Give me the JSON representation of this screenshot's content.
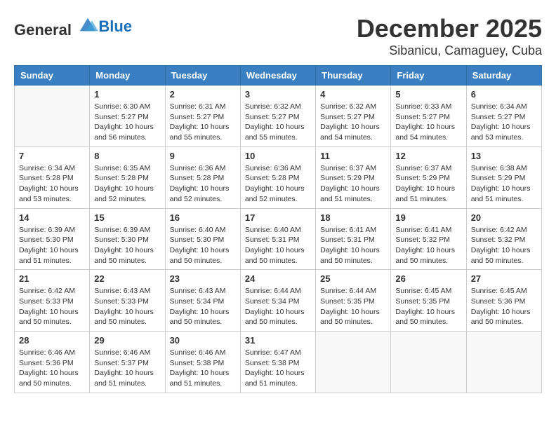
{
  "header": {
    "logo_general": "General",
    "logo_blue": "Blue",
    "month_year": "December 2025",
    "location": "Sibanicu, Camaguey, Cuba"
  },
  "days_of_week": [
    "Sunday",
    "Monday",
    "Tuesday",
    "Wednesday",
    "Thursday",
    "Friday",
    "Saturday"
  ],
  "weeks": [
    [
      {
        "day": "",
        "info": ""
      },
      {
        "day": "1",
        "info": "Sunrise: 6:30 AM\nSunset: 5:27 PM\nDaylight: 10 hours\nand 56 minutes."
      },
      {
        "day": "2",
        "info": "Sunrise: 6:31 AM\nSunset: 5:27 PM\nDaylight: 10 hours\nand 55 minutes."
      },
      {
        "day": "3",
        "info": "Sunrise: 6:32 AM\nSunset: 5:27 PM\nDaylight: 10 hours\nand 55 minutes."
      },
      {
        "day": "4",
        "info": "Sunrise: 6:32 AM\nSunset: 5:27 PM\nDaylight: 10 hours\nand 54 minutes."
      },
      {
        "day": "5",
        "info": "Sunrise: 6:33 AM\nSunset: 5:27 PM\nDaylight: 10 hours\nand 54 minutes."
      },
      {
        "day": "6",
        "info": "Sunrise: 6:34 AM\nSunset: 5:27 PM\nDaylight: 10 hours\nand 53 minutes."
      }
    ],
    [
      {
        "day": "7",
        "info": "Sunrise: 6:34 AM\nSunset: 5:28 PM\nDaylight: 10 hours\nand 53 minutes."
      },
      {
        "day": "8",
        "info": "Sunrise: 6:35 AM\nSunset: 5:28 PM\nDaylight: 10 hours\nand 52 minutes."
      },
      {
        "day": "9",
        "info": "Sunrise: 6:36 AM\nSunset: 5:28 PM\nDaylight: 10 hours\nand 52 minutes."
      },
      {
        "day": "10",
        "info": "Sunrise: 6:36 AM\nSunset: 5:28 PM\nDaylight: 10 hours\nand 52 minutes."
      },
      {
        "day": "11",
        "info": "Sunrise: 6:37 AM\nSunset: 5:29 PM\nDaylight: 10 hours\nand 51 minutes."
      },
      {
        "day": "12",
        "info": "Sunrise: 6:37 AM\nSunset: 5:29 PM\nDaylight: 10 hours\nand 51 minutes."
      },
      {
        "day": "13",
        "info": "Sunrise: 6:38 AM\nSunset: 5:29 PM\nDaylight: 10 hours\nand 51 minutes."
      }
    ],
    [
      {
        "day": "14",
        "info": "Sunrise: 6:39 AM\nSunset: 5:30 PM\nDaylight: 10 hours\nand 51 minutes."
      },
      {
        "day": "15",
        "info": "Sunrise: 6:39 AM\nSunset: 5:30 PM\nDaylight: 10 hours\nand 50 minutes."
      },
      {
        "day": "16",
        "info": "Sunrise: 6:40 AM\nSunset: 5:30 PM\nDaylight: 10 hours\nand 50 minutes."
      },
      {
        "day": "17",
        "info": "Sunrise: 6:40 AM\nSunset: 5:31 PM\nDaylight: 10 hours\nand 50 minutes."
      },
      {
        "day": "18",
        "info": "Sunrise: 6:41 AM\nSunset: 5:31 PM\nDaylight: 10 hours\nand 50 minutes."
      },
      {
        "day": "19",
        "info": "Sunrise: 6:41 AM\nSunset: 5:32 PM\nDaylight: 10 hours\nand 50 minutes."
      },
      {
        "day": "20",
        "info": "Sunrise: 6:42 AM\nSunset: 5:32 PM\nDaylight: 10 hours\nand 50 minutes."
      }
    ],
    [
      {
        "day": "21",
        "info": "Sunrise: 6:42 AM\nSunset: 5:33 PM\nDaylight: 10 hours\nand 50 minutes."
      },
      {
        "day": "22",
        "info": "Sunrise: 6:43 AM\nSunset: 5:33 PM\nDaylight: 10 hours\nand 50 minutes."
      },
      {
        "day": "23",
        "info": "Sunrise: 6:43 AM\nSunset: 5:34 PM\nDaylight: 10 hours\nand 50 minutes."
      },
      {
        "day": "24",
        "info": "Sunrise: 6:44 AM\nSunset: 5:34 PM\nDaylight: 10 hours\nand 50 minutes."
      },
      {
        "day": "25",
        "info": "Sunrise: 6:44 AM\nSunset: 5:35 PM\nDaylight: 10 hours\nand 50 minutes."
      },
      {
        "day": "26",
        "info": "Sunrise: 6:45 AM\nSunset: 5:35 PM\nDaylight: 10 hours\nand 50 minutes."
      },
      {
        "day": "27",
        "info": "Sunrise: 6:45 AM\nSunset: 5:36 PM\nDaylight: 10 hours\nand 50 minutes."
      }
    ],
    [
      {
        "day": "28",
        "info": "Sunrise: 6:46 AM\nSunset: 5:36 PM\nDaylight: 10 hours\nand 50 minutes."
      },
      {
        "day": "29",
        "info": "Sunrise: 6:46 AM\nSunset: 5:37 PM\nDaylight: 10 hours\nand 51 minutes."
      },
      {
        "day": "30",
        "info": "Sunrise: 6:46 AM\nSunset: 5:38 PM\nDaylight: 10 hours\nand 51 minutes."
      },
      {
        "day": "31",
        "info": "Sunrise: 6:47 AM\nSunset: 5:38 PM\nDaylight: 10 hours\nand 51 minutes."
      },
      {
        "day": "",
        "info": ""
      },
      {
        "day": "",
        "info": ""
      },
      {
        "day": "",
        "info": ""
      }
    ]
  ]
}
